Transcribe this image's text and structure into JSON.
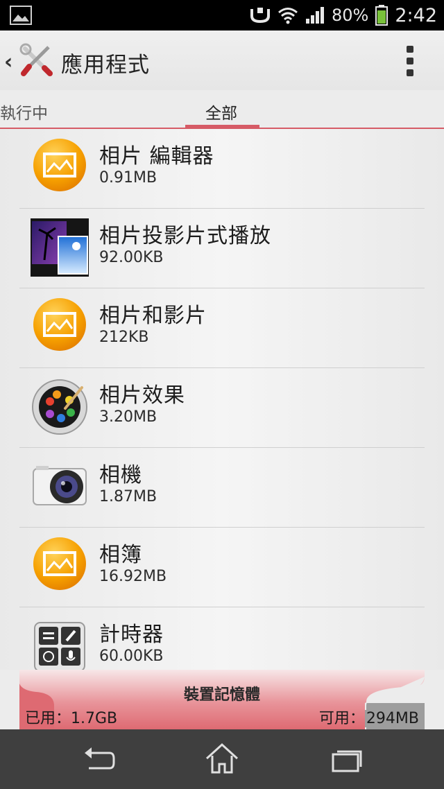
{
  "status_bar": {
    "battery_percent": "80%",
    "clock": "2:42",
    "icons": [
      "image-icon",
      "usb-icon",
      "wifi-icon",
      "signal-icon",
      "battery-icon"
    ]
  },
  "action_bar": {
    "back_glyph": "‹",
    "title": "應用程式",
    "icon": "tools-icon",
    "overflow": "overflow-menu-icon"
  },
  "tabs": {
    "running": "執行中",
    "all": "全部",
    "selected": "all",
    "accent_color": "#d65b66"
  },
  "apps": [
    {
      "name": "相片 編輯器",
      "size": "0.91MB",
      "icon": "photo-editor-icon"
    },
    {
      "name": "相片投影片式播放",
      "size": "92.00KB",
      "icon": "slideshow-icon"
    },
    {
      "name": "相片和影片",
      "size": "212KB",
      "icon": "photos-videos-icon"
    },
    {
      "name": "相片效果",
      "size": "3.20MB",
      "icon": "palette-icon"
    },
    {
      "name": "相機",
      "size": "1.87MB",
      "icon": "camera-icon"
    },
    {
      "name": "相簿",
      "size": "16.92MB",
      "icon": "album-icon"
    },
    {
      "name": "計時器",
      "size": "60.00KB",
      "icon": "timer-tools-icon"
    }
  ],
  "storage": {
    "title": "裝置記憶體",
    "used_label": "已用：1.7GB",
    "free_prefix": "可用：",
    "free_value": "294MB",
    "bar_color": "#de6a72"
  },
  "nav_bar": {
    "icons": [
      "back-icon",
      "home-icon",
      "recent-apps-icon"
    ]
  }
}
